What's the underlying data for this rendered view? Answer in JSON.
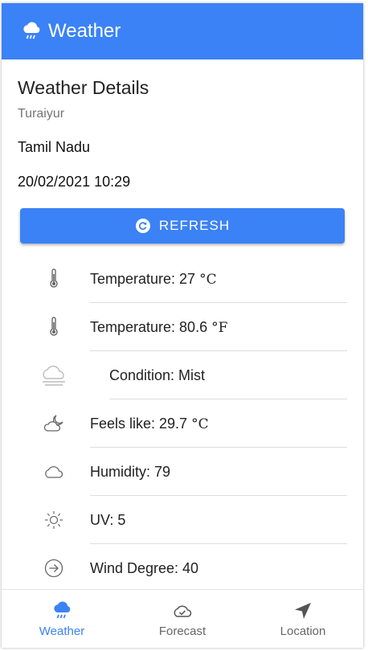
{
  "appbar": {
    "title": "Weather",
    "icon": "rain-cloud-icon"
  },
  "details": {
    "title": "Weather Details",
    "city": "Turaiyur",
    "state": "Tamil Nadu",
    "datetime": "20/02/2021 10:29",
    "refresh_label": "REFRESH"
  },
  "rows": [
    {
      "label": "Temperature: 27 ",
      "unit": "°C",
      "icon": "thermometer-icon"
    },
    {
      "label": "Temperature: 80.6 ",
      "unit": "°F",
      "icon": "thermometer-icon"
    },
    {
      "label": "Condition: Mist",
      "unit": "",
      "icon": "mist-icon"
    },
    {
      "label": "Feels like: 29.7 ",
      "unit": "°C",
      "icon": "cloudy-night-icon"
    },
    {
      "label": "Humidity: 79",
      "unit": "",
      "icon": "cloud-icon"
    },
    {
      "label": "UV: 5",
      "unit": "",
      "icon": "sun-icon"
    },
    {
      "label": "Wind Degree: 40",
      "unit": "",
      "icon": "arrow-circle-icon"
    }
  ],
  "nav": {
    "weather": "Weather",
    "forecast": "Forecast",
    "location": "Location"
  },
  "colors": {
    "primary": "#3b82f6"
  }
}
